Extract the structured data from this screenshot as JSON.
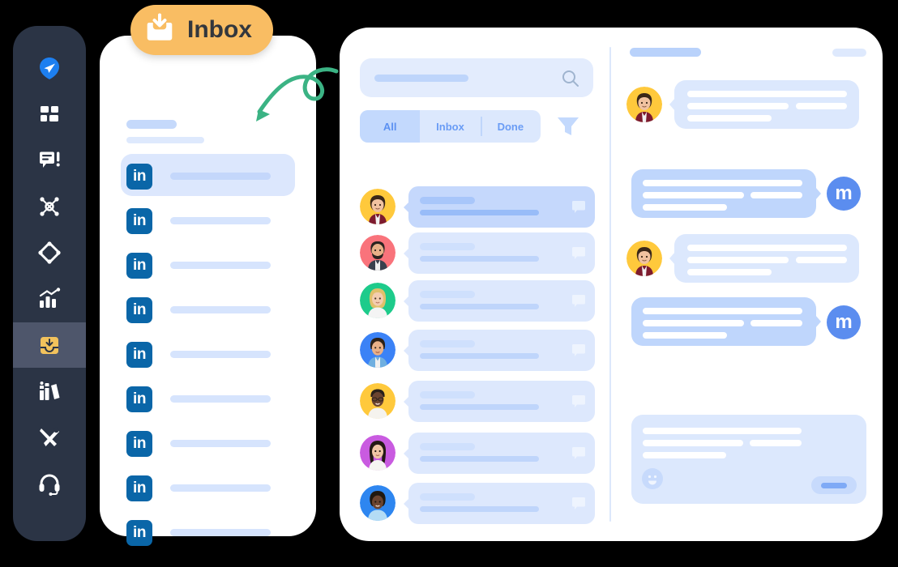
{
  "theme": {
    "sidebar_bg": "#2B3445",
    "sidebar_active_bg": "#4E566B",
    "badge_bg": "#F9BD63",
    "badge_text_color": "#33373D",
    "accent_blue": "#5B8DEF",
    "tab_active_bg": "#C3D9FD",
    "arrow_color": "#3BB384",
    "linkedin_blue": "#0A66A8"
  },
  "sidebar": {
    "items": [
      {
        "icon": "paper-plane-icon",
        "label": "Send",
        "active": false
      },
      {
        "icon": "grid-dashboard-icon",
        "label": "Dashboard",
        "active": false
      },
      {
        "icon": "chat-alert-icon",
        "label": "Messages",
        "active": false
      },
      {
        "icon": "network-nodes-icon",
        "label": "Network",
        "active": false
      },
      {
        "icon": "diamond-icon",
        "label": "Campaigns",
        "active": false
      },
      {
        "icon": "analytics-chart-icon",
        "label": "Analytics",
        "active": false
      },
      {
        "icon": "inbox-icon",
        "label": "Inbox",
        "active": true
      },
      {
        "icon": "books-icon",
        "label": "Library",
        "active": false
      },
      {
        "icon": "tools-icon",
        "label": "Tools",
        "active": false
      },
      {
        "icon": "headset-icon",
        "label": "Support",
        "active": false
      }
    ]
  },
  "badge": {
    "label": "Inbox",
    "icon": "inbox-download-icon"
  },
  "annotation": {
    "arrow": "curly-arrow-icon",
    "points_to": "first-linkedin-conversation"
  },
  "phone_panel": {
    "header": {
      "line1": "",
      "line2": ""
    },
    "items": [
      {
        "icon": "linkedin-icon",
        "label": "in",
        "selected": true
      },
      {
        "icon": "linkedin-icon",
        "label": "in",
        "selected": false
      },
      {
        "icon": "linkedin-icon",
        "label": "in",
        "selected": false
      },
      {
        "icon": "linkedin-icon",
        "label": "in",
        "selected": false
      },
      {
        "icon": "linkedin-icon",
        "label": "in",
        "selected": false
      },
      {
        "icon": "linkedin-icon",
        "label": "in",
        "selected": false
      },
      {
        "icon": "linkedin-icon",
        "label": "in",
        "selected": false
      },
      {
        "icon": "linkedin-icon",
        "label": "in",
        "selected": false
      },
      {
        "icon": "linkedin-icon",
        "label": "in",
        "selected": false
      }
    ]
  },
  "main_panel": {
    "search": {
      "placeholder": "",
      "value": "",
      "icon": "search-icon"
    },
    "tabs": [
      {
        "label": "All",
        "active": true
      },
      {
        "label": "Inbox",
        "active": false
      },
      {
        "label": "Done",
        "active": false
      }
    ],
    "filter": {
      "icon": "filter-funnel-icon",
      "label": "Filter"
    },
    "conversations": [
      {
        "avatar": "avatar-curly-yellow",
        "avatar_bg": "#FFC93C",
        "unread": true,
        "icon": "chat-bubble-icon"
      },
      {
        "avatar": "avatar-beard-red",
        "avatar_bg": "#F9737B",
        "unread": false,
        "icon": "chat-bubble-icon"
      },
      {
        "avatar": "avatar-blonde-green",
        "avatar_bg": "#1ECB8B",
        "unread": false,
        "icon": "chat-bubble-icon"
      },
      {
        "avatar": "avatar-man-blue",
        "avatar_bg": "#3B82F6",
        "unread": false,
        "icon": "chat-bubble-icon"
      },
      {
        "avatar": "avatar-glasses-yellow",
        "avatar_bg": "#FFC93C",
        "unread": false,
        "icon": "chat-bubble-icon"
      },
      {
        "avatar": "avatar-woman-purple",
        "avatar_bg": "#C95BE0",
        "unread": false,
        "icon": "chat-bubble-icon"
      },
      {
        "avatar": "avatar-child-blue",
        "avatar_bg": "#2E86F0",
        "unread": false,
        "icon": "chat-bubble-icon"
      }
    ]
  },
  "conversation_panel": {
    "header": {
      "title_line": "",
      "meta_line": ""
    },
    "messages": [
      {
        "direction": "incoming",
        "avatar": "avatar-curly-yellow",
        "avatar_bg": "#FFC93C",
        "lines": 3
      },
      {
        "direction": "outgoing",
        "avatar": "m-avatar",
        "avatar_label": "m",
        "lines": 3
      },
      {
        "direction": "incoming",
        "avatar": "avatar-curly-yellow",
        "avatar_bg": "#FFC93C",
        "lines": 3
      },
      {
        "direction": "outgoing",
        "avatar": "m-avatar",
        "avatar_label": "m",
        "lines": 3
      }
    ],
    "compose": {
      "placeholder": "",
      "emoji_icon": "smiley-icon",
      "send_icon": "send-button"
    }
  }
}
